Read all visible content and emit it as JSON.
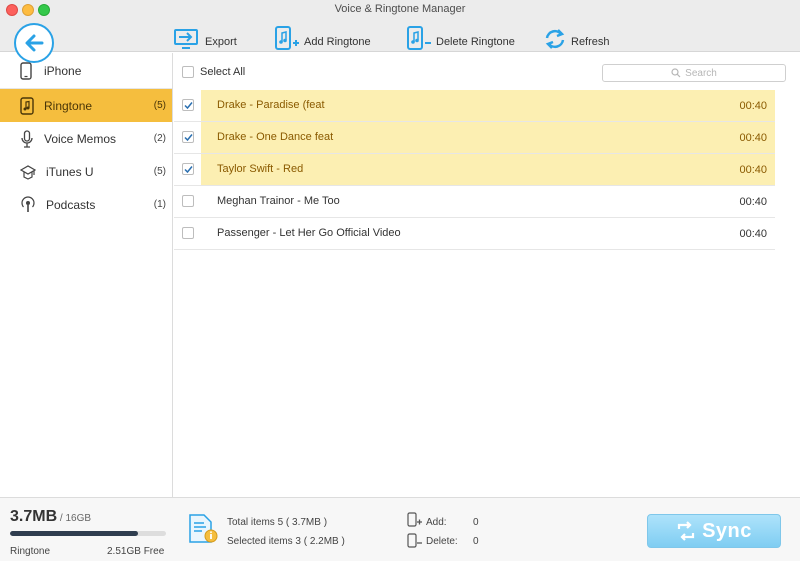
{
  "window": {
    "title": "Voice & Ringtone Manager"
  },
  "toolbar": {
    "export_label": "Export",
    "add_label": "Add Ringtone",
    "delete_label": "Delete Ringtone",
    "refresh_label": "Refresh"
  },
  "sidebar": {
    "device": "iPhone",
    "items": [
      {
        "label": "Ringtone",
        "count": "(5)",
        "icon": "ringtone-icon",
        "active": true
      },
      {
        "label": "Voice Memos",
        "count": "(2)",
        "icon": "microphone-icon",
        "active": false
      },
      {
        "label": "iTunes U",
        "count": "(5)",
        "icon": "graduation-cap-icon",
        "active": false
      },
      {
        "label": "Podcasts",
        "count": "(1)",
        "icon": "podcast-icon",
        "active": false
      }
    ]
  },
  "list": {
    "select_all_label": "Select All",
    "search_placeholder": "Search",
    "rows": [
      {
        "title": "Drake - Paradise (feat",
        "time": "00:40",
        "checked": true
      },
      {
        "title": "Drake - One Dance feat",
        "time": "00:40",
        "checked": true
      },
      {
        "title": "Taylor Swift - Red",
        "time": "00:40",
        "checked": true
      },
      {
        "title": "Meghan Trainor - Me Too",
        "time": "00:40",
        "checked": false
      },
      {
        "title": "Passenger - Let Her Go Official Video",
        "time": "00:40",
        "checked": false
      }
    ]
  },
  "footer": {
    "storage_used": "3.7MB",
    "storage_total": " / 16GB",
    "storage_fraction": 0.82,
    "storage_category": "Ringtone",
    "storage_free": "2.51GB Free",
    "total_items": "Total items 5 ( 3.7MB )",
    "selected_items": "Selected items 3 ( 2.2MB )",
    "add_label": "Add:",
    "add_value": "0",
    "delete_label": "Delete:",
    "delete_value": "0",
    "sync_label": "Sync"
  },
  "colors": {
    "accent": "#2aa2e6",
    "active_category": "#f5be3e",
    "selected_row": "#fcefb2",
    "selected_text": "#8a5a00",
    "sync_button": "#8fd5f6"
  }
}
